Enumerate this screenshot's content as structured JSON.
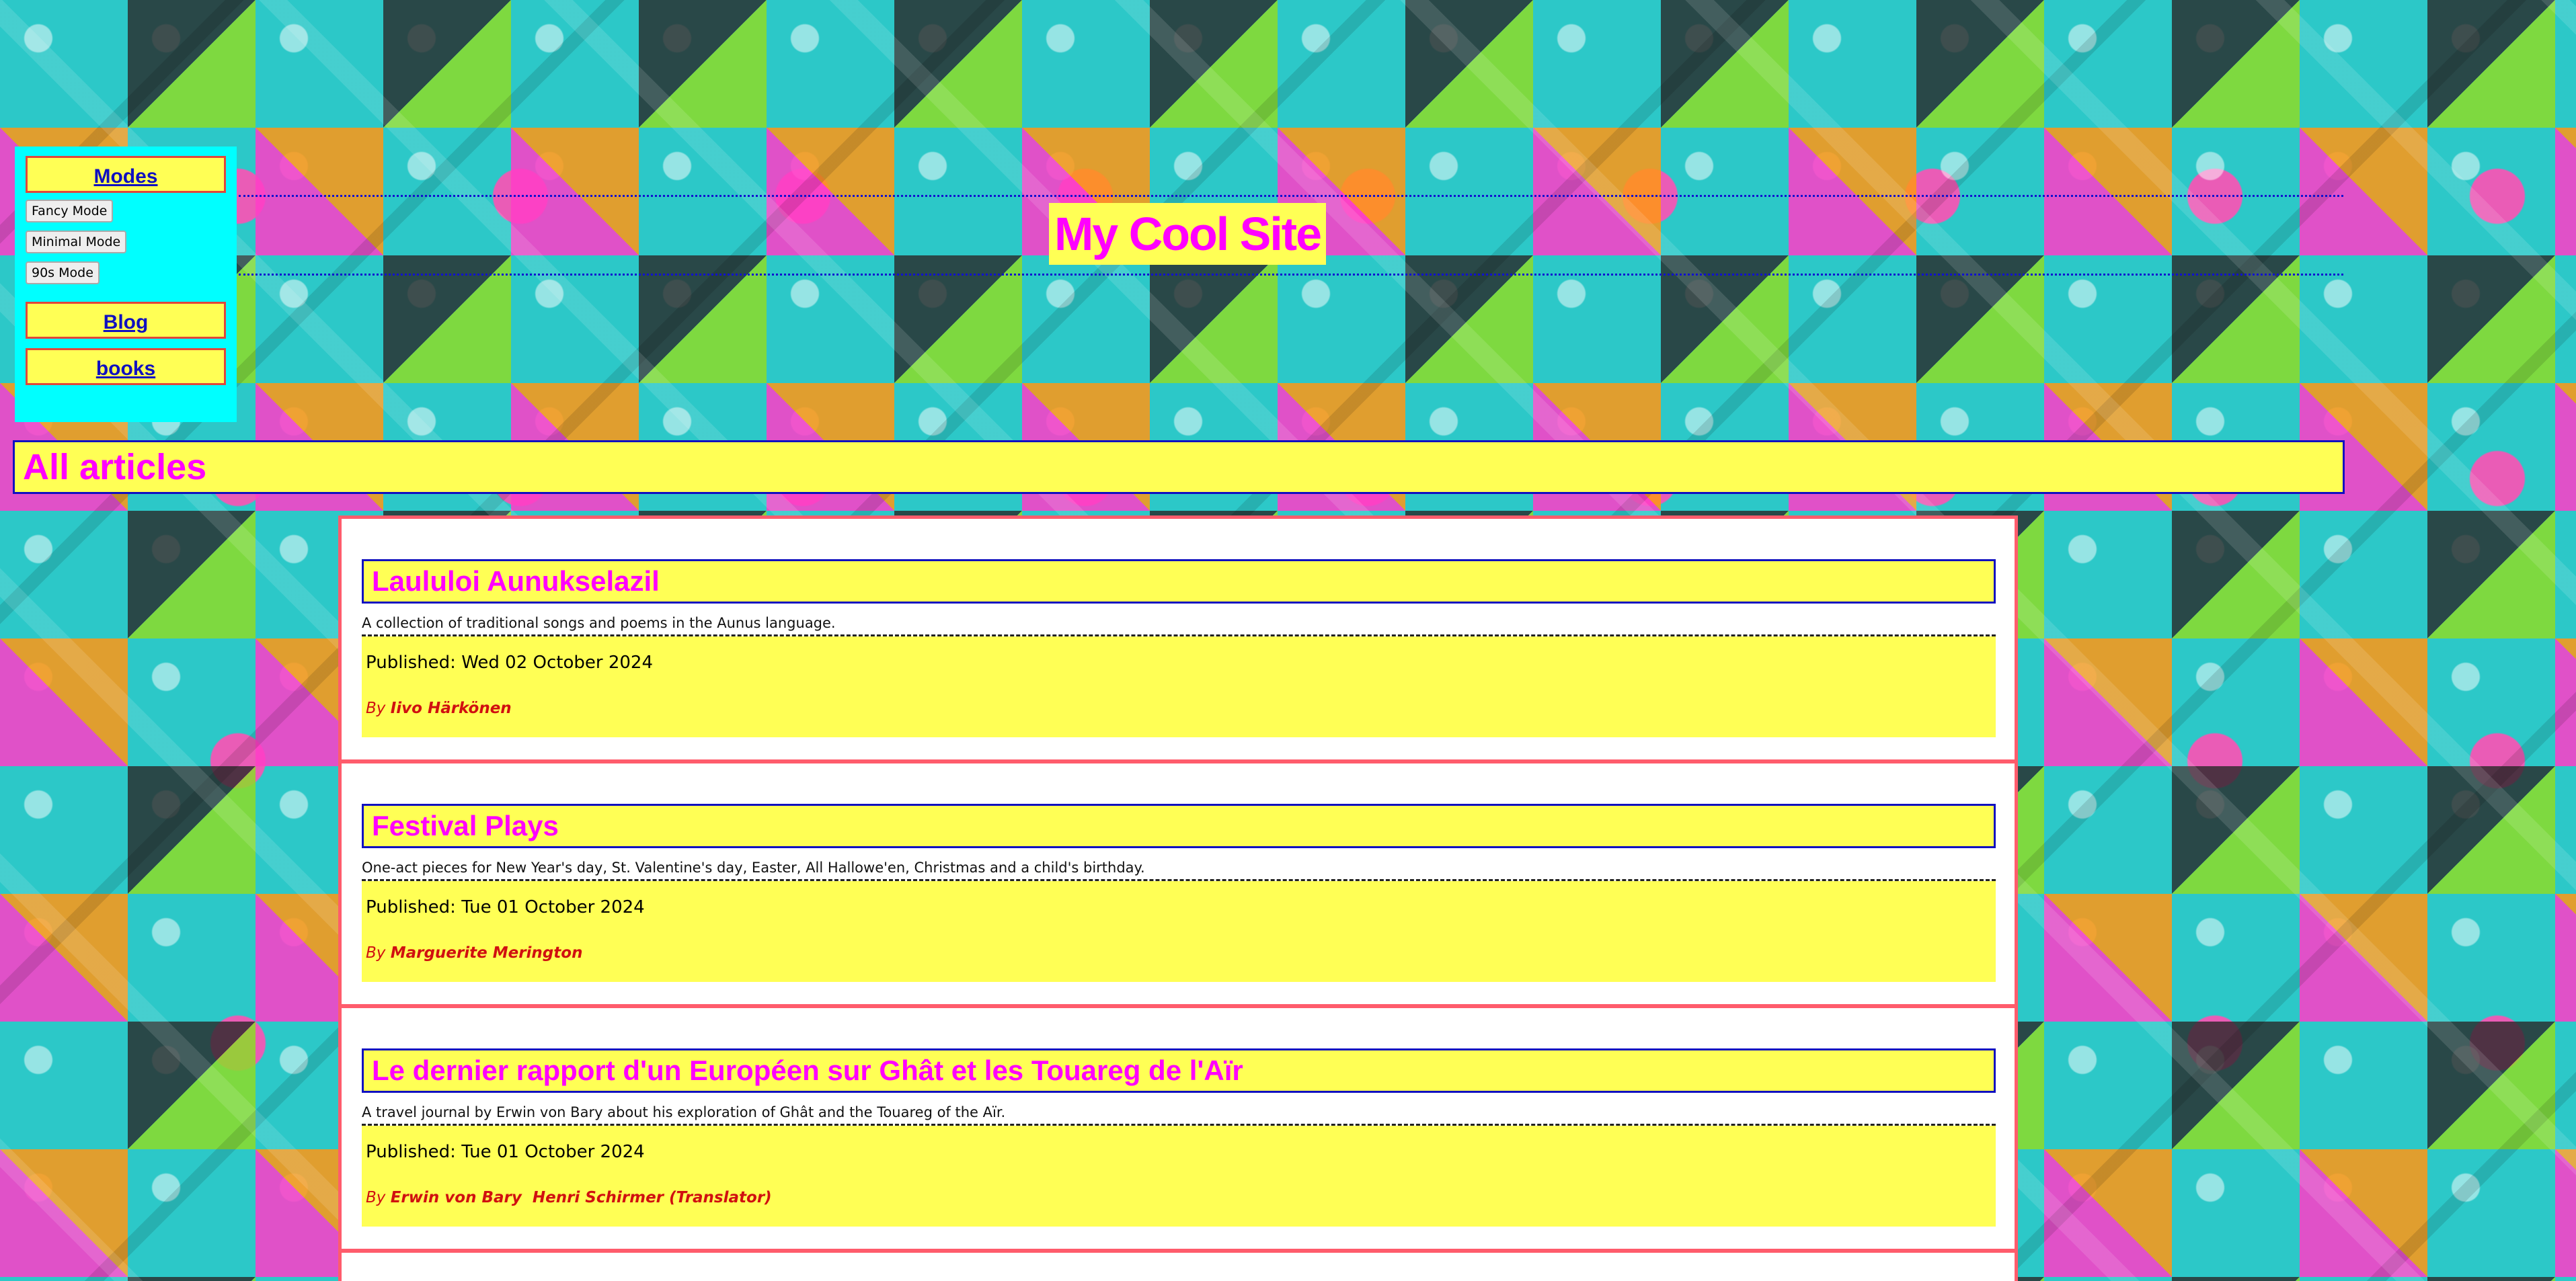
{
  "colors": {
    "background_base": "#2cc8c8",
    "panel_yellow": "#ffff55",
    "accent_magenta": "#ff00ff",
    "link_blue": "#1010c0",
    "sidebar_cyan": "#00ffff",
    "card_border": "#ff5c6c"
  },
  "site": {
    "title": "My Cool Site"
  },
  "sidebar": {
    "modes_label": "Modes",
    "mode_buttons": [
      "Fancy Mode",
      "Minimal Mode",
      "90s Mode"
    ],
    "blog_label": "Blog",
    "books_label": "books"
  },
  "section": {
    "title": "All articles"
  },
  "articles": [
    {
      "title": "Laululoi Aunukselazil",
      "description": "A collection of traditional songs and poems in the Aunus language.",
      "published": "Published: Wed 02 October 2024",
      "by": "By",
      "author": "Iivo Härkönen"
    },
    {
      "title": "Festival Plays",
      "description": "One-act pieces for New Year's day, St. Valentine's day, Easter, All Hallowe'en, Christmas and a child's birthday.",
      "published": "Published: Tue 01 October 2024",
      "by": "By",
      "author": "Marguerite Merington"
    },
    {
      "title": "Le dernier rapport d'un Européen sur Ghât et les Touareg de l'Aïr",
      "description": "A travel journal by Erwin von Bary about his exploration of Ghât and the Touareg of the Aïr.",
      "published": "Published: Tue 01 October 2024",
      "by": "By",
      "author": "Erwin von Bary  Henri Schirmer (Translator)"
    }
  ]
}
